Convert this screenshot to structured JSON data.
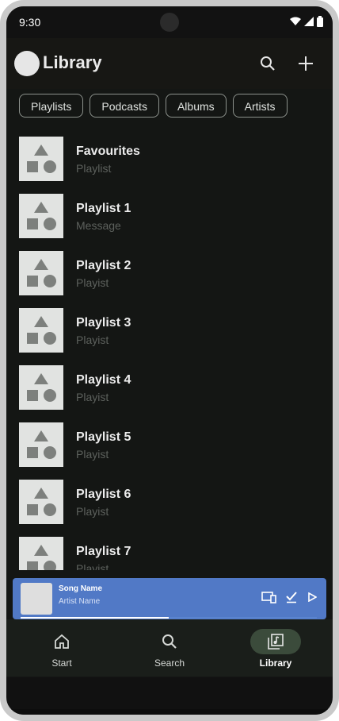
{
  "status_bar": {
    "time": "9:30"
  },
  "header": {
    "title": "Library"
  },
  "chips": [
    "Playlists",
    "Podcasts",
    "Albums",
    "Artists"
  ],
  "playlists": [
    {
      "name": "Favourites",
      "subtitle": "Playlist"
    },
    {
      "name": "Playlist 1",
      "subtitle": "Message"
    },
    {
      "name": "Playlist 2",
      "subtitle": "Playist"
    },
    {
      "name": "Playlist 3",
      "subtitle": "Playist"
    },
    {
      "name": "Playlist 4",
      "subtitle": "Playist"
    },
    {
      "name": "Playlist 5",
      "subtitle": "Playist"
    },
    {
      "name": "Playlist 6",
      "subtitle": "Playist"
    },
    {
      "name": "Playlist 7",
      "subtitle": "Playist"
    }
  ],
  "mini_player": {
    "song": "Song Name",
    "artist": "Artist Name",
    "progress": 0.5
  },
  "bottom_nav": [
    {
      "label": "Start",
      "icon": "home-icon",
      "active": false
    },
    {
      "label": "Search",
      "icon": "search-icon",
      "active": false
    },
    {
      "label": "Library",
      "icon": "library-icon",
      "active": true
    }
  ],
  "colors": {
    "accent_player": "#5179c6",
    "background": "#141614",
    "nav_active": "#3b4b3b"
  }
}
